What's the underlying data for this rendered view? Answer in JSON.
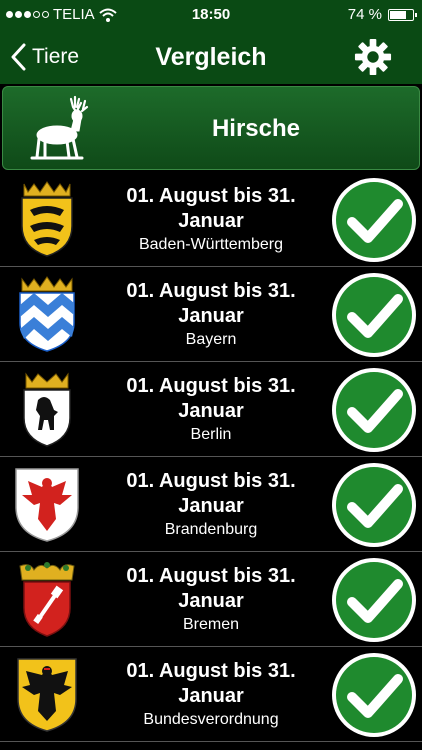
{
  "status_bar": {
    "carrier": "TELIA",
    "time": "18:50",
    "battery": "74 %",
    "battery_level": 0.74
  },
  "nav": {
    "back_label": "Tiere",
    "title": "Vergleich"
  },
  "category": {
    "title": "Hirsche"
  },
  "rows": [
    {
      "dates": "01. August bis 31. Januar",
      "state": "Baden-Württemberg"
    },
    {
      "dates": "01. August bis 31. Januar",
      "state": "Bayern"
    },
    {
      "dates": "01. August bis 31. Januar",
      "state": "Berlin"
    },
    {
      "dates": "01. August bis 31. Januar",
      "state": "Brandenburg"
    },
    {
      "dates": "01. August bis 31. Januar",
      "state": "Bremen"
    },
    {
      "dates": "01. August bis 31. Januar",
      "state": "Bundesverordnung"
    }
  ],
  "colors": {
    "bar_green": "#0a4a14",
    "check_green": "#1f8a2e"
  }
}
